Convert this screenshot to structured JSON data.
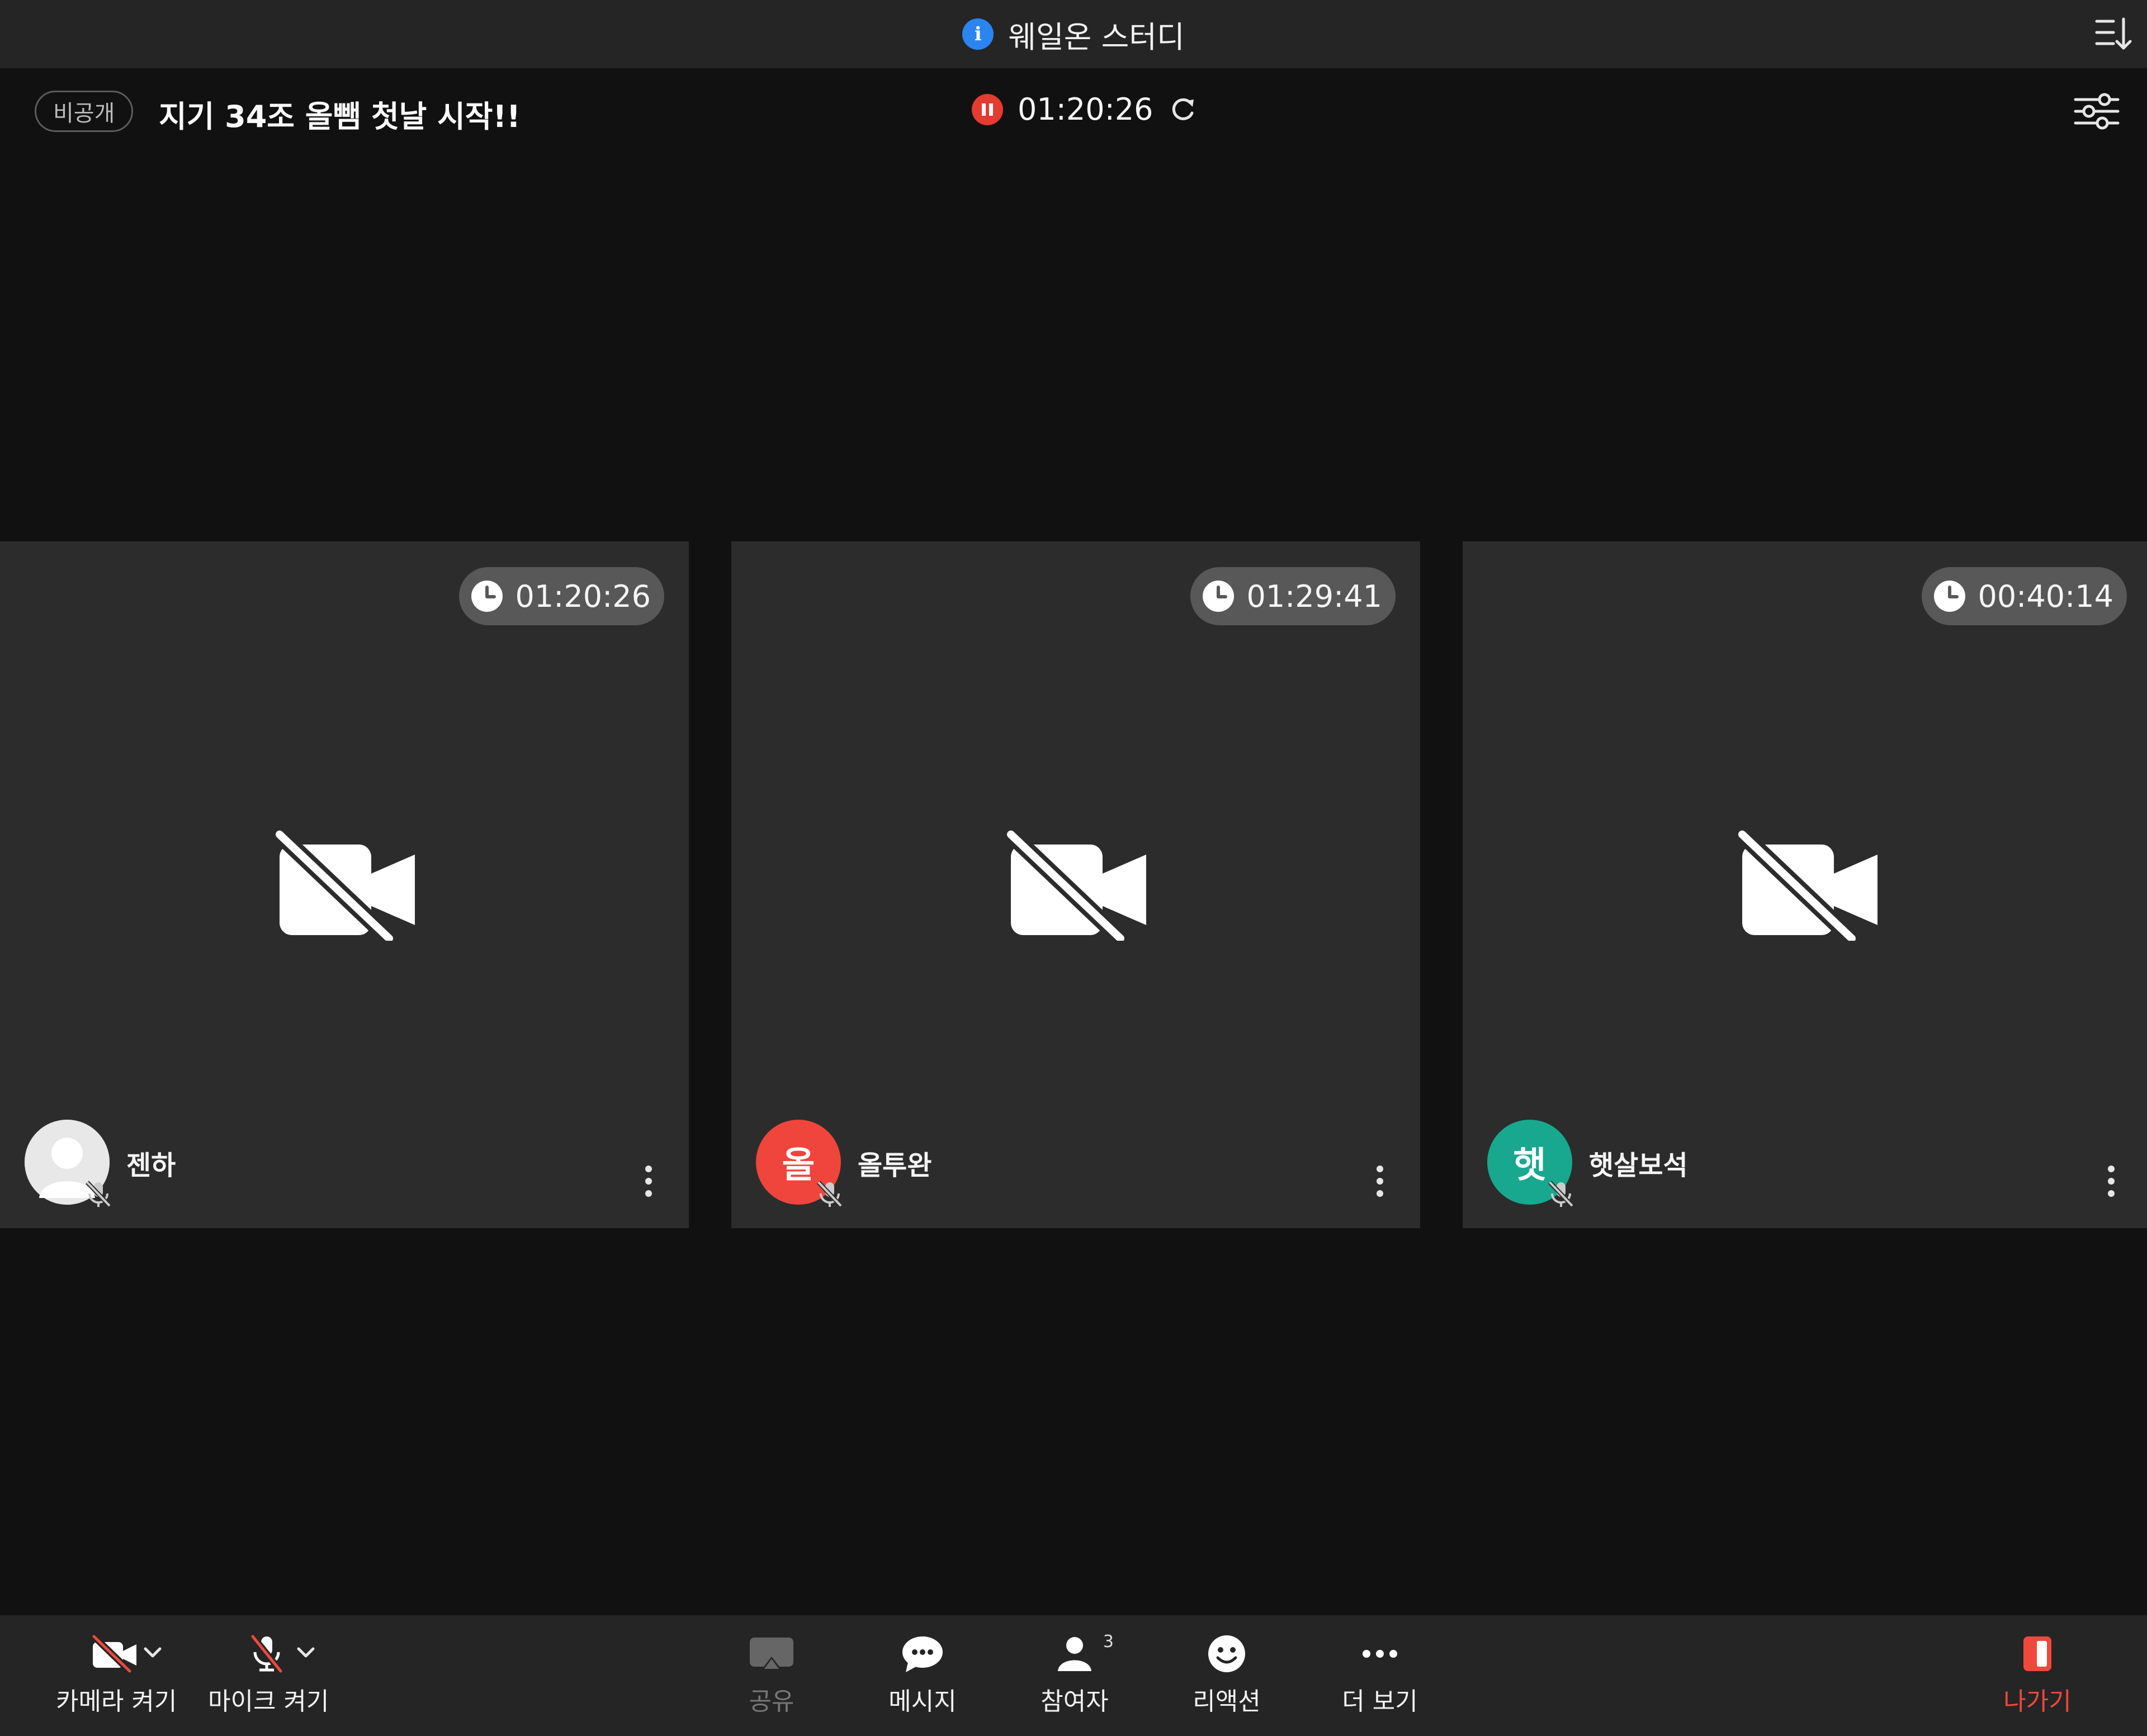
{
  "app": {
    "title": "웨일온 스터디",
    "info_icon": "info-icon"
  },
  "room": {
    "visibility_badge": "비공개",
    "title": "지기 34조 올뺌 첫날 시작!!",
    "recording_time": "01:20:26"
  },
  "participants": [
    {
      "name": "젠하",
      "timer": "01:20:26",
      "avatar_text": "",
      "avatar_color": "#e8e8e8"
    },
    {
      "name": "올투완",
      "timer": "01:29:41",
      "avatar_text": "올",
      "avatar_color": "#f0453c"
    },
    {
      "name": "햇살보석",
      "timer": "00:40:14",
      "avatar_text": "햇",
      "avatar_color": "#18a88f"
    }
  ],
  "toolbar": {
    "camera": "카메라 켜기",
    "mic": "마이크 켜기",
    "share": "공유",
    "message": "메시지",
    "participants": "참여자",
    "participants_count": "3",
    "reaction": "리액션",
    "more": "더 보기",
    "exit": "나가기"
  },
  "colors": {
    "accent_red": "#f0483c",
    "info_blue": "#2b85f0",
    "tile_bg": "#2c2c2c",
    "background": "#111111"
  }
}
